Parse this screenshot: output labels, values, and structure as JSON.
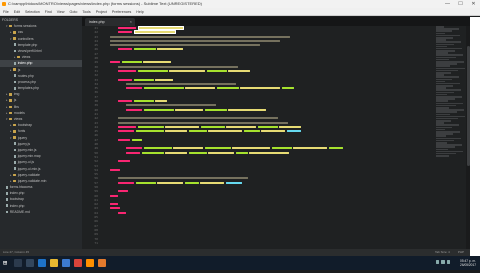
{
  "window": {
    "title_path": "C:\\xampp\\htdocs\\MONTRO\\views\\pages\\views\\index.php (forms sessions) - Sublime Text (UNREGISTERED)",
    "app_name": "Sublime Text (UNREGISTERED)",
    "minimize": "—",
    "maximize": "☐",
    "close": "✕"
  },
  "menu": [
    "File",
    "Edit",
    "Selection",
    "Find",
    "View",
    "Goto",
    "Tools",
    "Project",
    "Preferences",
    "Help"
  ],
  "sidebar": {
    "items": [
      {
        "label": "FOLDERS",
        "type": "header",
        "indent": 0
      },
      {
        "label": "forms sessions",
        "type": "folder",
        "indent": 1,
        "open": true
      },
      {
        "label": "css",
        "type": "folder",
        "indent": 2
      },
      {
        "label": "controllers",
        "type": "folder",
        "indent": 2,
        "open": true
      },
      {
        "label": "template.php",
        "type": "file",
        "indent": 3
      },
      {
        "label": "views/perfil.html",
        "type": "file",
        "indent": 3
      },
      {
        "label": "views",
        "type": "folder",
        "indent": 3
      },
      {
        "label": "index.php",
        "type": "file",
        "indent": 3,
        "active": true
      },
      {
        "label": "js",
        "type": "folder",
        "indent": 2
      },
      {
        "label": "routes.php",
        "type": "file",
        "indent": 3
      },
      {
        "label": "process.php",
        "type": "file",
        "indent": 3
      },
      {
        "label": "templates.php",
        "type": "file",
        "indent": 3
      },
      {
        "label": "img",
        "type": "folder",
        "indent": 1
      },
      {
        "label": "js",
        "type": "folder",
        "indent": 1
      },
      {
        "label": "libs",
        "type": "folder",
        "indent": 1
      },
      {
        "label": "models",
        "type": "folder",
        "indent": 1
      },
      {
        "label": "views",
        "type": "folder",
        "indent": 1,
        "open": true
      },
      {
        "label": "bootstrap",
        "type": "folder",
        "indent": 2
      },
      {
        "label": "fonts",
        "type": "folder",
        "indent": 2
      },
      {
        "label": "jquery",
        "type": "folder",
        "indent": 2,
        "open": true
      },
      {
        "label": "jquery.js",
        "type": "file",
        "indent": 3
      },
      {
        "label": "jquery.min.js",
        "type": "file",
        "indent": 3
      },
      {
        "label": "jquery.min.map",
        "type": "file",
        "indent": 3
      },
      {
        "label": "jquery-ui.js",
        "type": "file",
        "indent": 3
      },
      {
        "label": "jquery-ui.min.js",
        "type": "file",
        "indent": 3
      },
      {
        "label": "jquery-validate",
        "type": "folder",
        "indent": 2
      },
      {
        "label": "jquery-validate.min",
        "type": "folder",
        "indent": 2
      },
      {
        "label": "forms.htaccess",
        "type": "file",
        "indent": 1
      },
      {
        "label": "index.php",
        "type": "file",
        "indent": 1
      },
      {
        "label": "bootstrap",
        "type": "file",
        "indent": 1
      },
      {
        "label": "index.php",
        "type": "file",
        "indent": 1
      },
      {
        "label": "README.md",
        "type": "file",
        "indent": 1
      }
    ]
  },
  "editor": {
    "tab_label": "index.php",
    "tab_close": "×",
    "line_start": 21,
    "line_count": 51
  },
  "statusbar": {
    "left": "Line 27, Column 45",
    "spaces": "Tab Size: 4",
    "syntax": "PHP"
  },
  "taskbar": {
    "time": "05:47 p. m.",
    "date": "26/05/2017",
    "start_glyph": "⊞"
  },
  "colors": {
    "tag": "#f92672",
    "attribute": "#a6e22e",
    "string": "#e6db74",
    "comment": "#75715e",
    "function": "#66d9ef",
    "editor_bg": "#1f2122",
    "sidebar_bg": "#26292c"
  }
}
